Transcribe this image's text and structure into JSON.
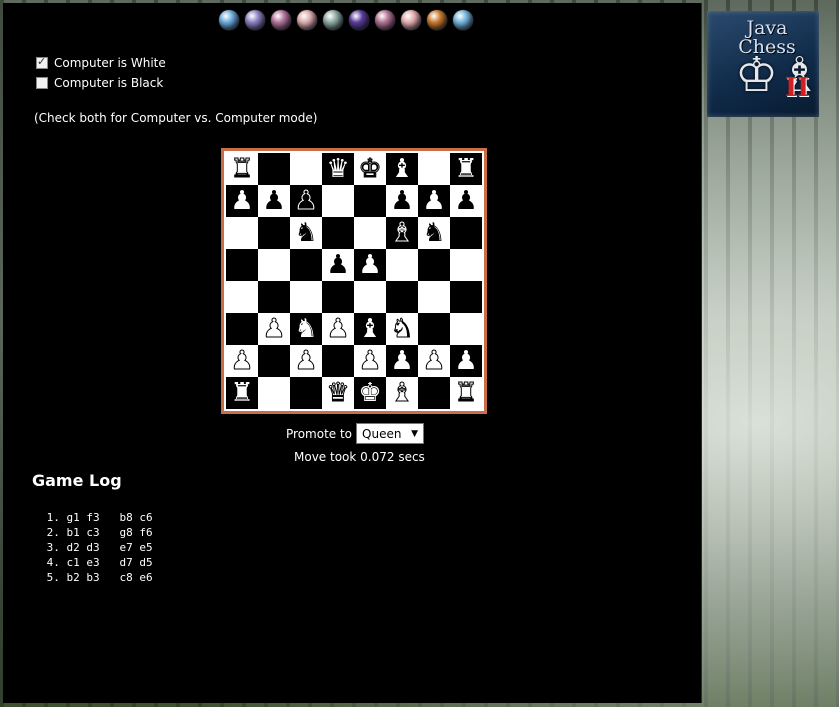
{
  "bead_colors": [
    "#6aa8d8",
    "#8a7fc0",
    "#b07098",
    "#d8a8a8",
    "#8aa8a0",
    "#5a3a9a",
    "#b07090",
    "#e0a8a8",
    "#c8782a",
    "#70b0d8"
  ],
  "options": {
    "computer_white_label": "Computer is White",
    "computer_white_checked": true,
    "computer_black_label": "Computer is Black",
    "computer_black_checked": false,
    "hint": "(Check both for Computer vs. Computer mode)"
  },
  "board": {
    "ranks": [
      [
        "wR",
        "",
        "",
        "wQ",
        "wK",
        "wB",
        "",
        "wR"
      ],
      [
        "wP",
        "bP",
        "bP",
        "",
        "",
        "bP",
        "wP",
        "bP"
      ],
      [
        "",
        "",
        "bN",
        "",
        "",
        "bB",
        "bN",
        ""
      ],
      [
        "",
        "",
        "",
        "bP",
        "wP",
        "",
        "",
        ""
      ],
      [
        "",
        "",
        "",
        "",
        "",
        "",
        "",
        ""
      ],
      [
        "",
        "wP",
        "wN",
        "wP",
        "wB",
        "wN",
        "",
        ""
      ],
      [
        "wP",
        "",
        "wP",
        "",
        "wP",
        "wP",
        "wP",
        "wP"
      ],
      [
        "wR",
        "",
        "",
        "wQ",
        "wK",
        "wB",
        "",
        "wR"
      ]
    ]
  },
  "promote": {
    "label": "Promote to",
    "selected": "Queen"
  },
  "status": {
    "move_time": "Move took 0.072 secs"
  },
  "game_log": {
    "title": "Game Log",
    "moves": [
      " 1. g1 f3   b8 c6",
      " 2. b1 c3   g8 f6",
      " 3. d2 d3   e7 e5",
      " 4. c1 e3   d7 d5",
      " 5. b2 b3   c8 e6"
    ]
  },
  "logo": {
    "line1": "Java",
    "line2": "Chess",
    "roman": "II"
  }
}
